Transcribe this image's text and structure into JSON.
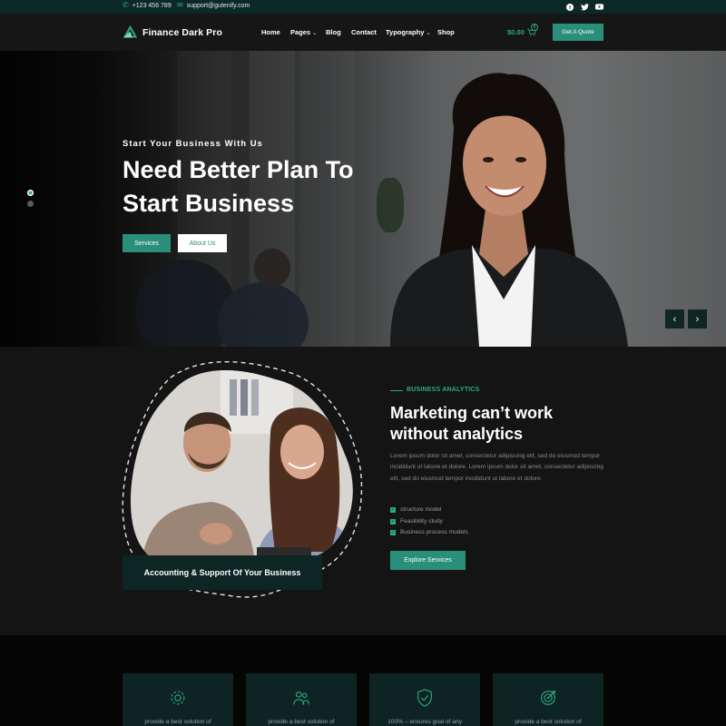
{
  "topbar": {
    "phone": "+123 456 789",
    "email": "support@gutenify.com",
    "social": [
      "facebook-icon",
      "twitter-icon",
      "youtube-icon"
    ]
  },
  "header": {
    "logo": "Finance Dark Pro",
    "nav": [
      {
        "label": "Home",
        "dropdown": false
      },
      {
        "label": "Pages",
        "dropdown": true
      },
      {
        "label": "Blog",
        "dropdown": false
      },
      {
        "label": "Contact",
        "dropdown": false
      },
      {
        "label": "Typography",
        "dropdown": true
      },
      {
        "label": "Shop",
        "dropdown": false
      }
    ],
    "cart_total": "$0.00",
    "cart_count": "0",
    "quote_button": "Get A Quote"
  },
  "hero": {
    "subtitle": "Start Your Business With Us",
    "title_line1": "Need Better Plan To",
    "title_line2": "Start Business",
    "btn_services": "Services",
    "btn_about": "About Us",
    "prev": "‹",
    "next": "›"
  },
  "analytics": {
    "photo_caption": "Accounting & Support Of Your Business",
    "label": "BUSINESS ANALYTICS",
    "title_line1": "Marketing can’t work",
    "title_line2": "without analytics",
    "paragraph": "Lorem ipsum dolor sit amet, consectetur adipiscing elit, sed do eiusmod tempor incididunt ut labore et dolore. Lorem ipsum dolor sit amet, consectetur adipiscing elit, sed do eiusmod tempor incididunt ut labore et dolore.",
    "checklist": [
      "structure model",
      "Feasibility study",
      "Business process models"
    ],
    "button": "Explore Services"
  },
  "features": [
    {
      "icon": "gear-icon",
      "text": "provide a best solution of"
    },
    {
      "icon": "team-icon",
      "text": "provide a best solution of"
    },
    {
      "icon": "shield-icon",
      "text": "100% – ensures goal of any"
    },
    {
      "icon": "target-icon",
      "text": "provide a best solution of"
    }
  ],
  "colors": {
    "accent": "#2a8f7a",
    "accent_light": "#2ea889",
    "topbar": "#0b2a27",
    "card": "#0e2422"
  }
}
